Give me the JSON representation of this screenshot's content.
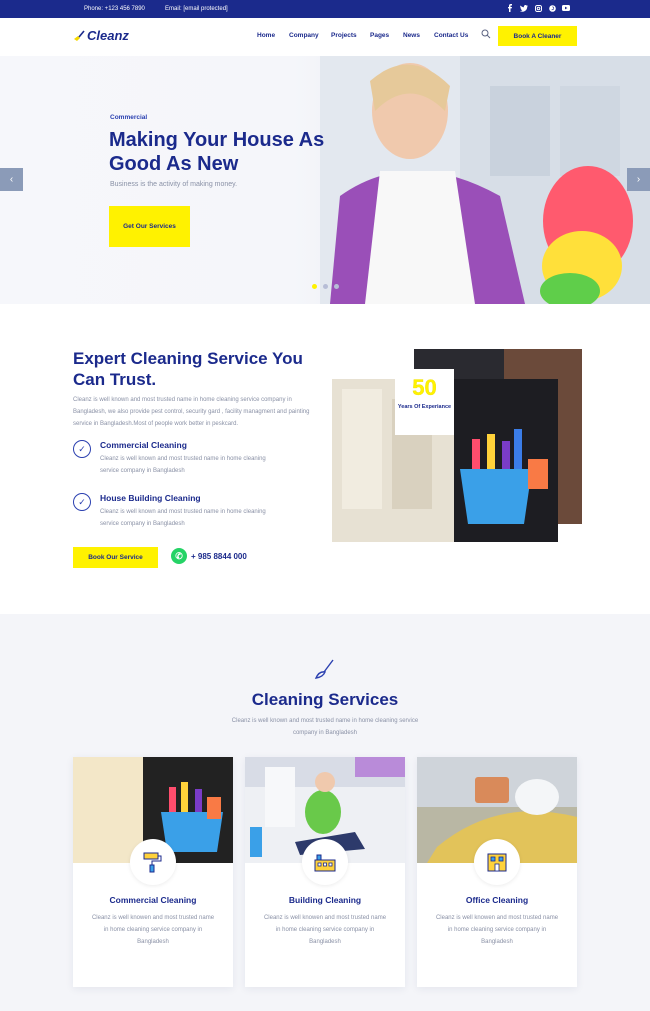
{
  "topbar": {
    "phone": "Phone: +123 456 7890",
    "email": "Email: [email protected]",
    "social": [
      "facebook-icon",
      "twitter-icon",
      "instagram-icon",
      "pinterest-icon",
      "youtube-icon"
    ]
  },
  "header": {
    "logo": "Cleanz",
    "nav": [
      "Home",
      "Company",
      "Projects",
      "Pages",
      "News",
      "Contact Us"
    ],
    "cta": "Book A Cleaner"
  },
  "hero": {
    "tag": "Commercial",
    "title": "Making Your House As Good As New",
    "subtitle": "Business is the activity of making money.",
    "button": "Get Our Services",
    "prev": "‹",
    "next": "›"
  },
  "about": {
    "title": "Expert Cleaning Service You Can Trust.",
    "description": "Cleanz is well known and most trusted name in home cleaning service company in Bangladesh, we also provide pest control, security gard , facility managment and painting service in Bangladesh.Most of people work better in peskcard.",
    "features": [
      {
        "title": "Commercial Cleaning",
        "desc": "Cleanz is well known and most trusted name in home cleaning service company in Bangladesh"
      },
      {
        "title": "House Building Cleaning",
        "desc": "Cleanz is well known and most trusted name in home cleaning service company in Bangladesh"
      }
    ],
    "button": "Book Our Service",
    "phone": "+ 985 8844 000",
    "badge_number": "50",
    "badge_label": "Years Of Experiance"
  },
  "services": {
    "title": "Cleaning Services",
    "lead": "Cleanz is well known and most trusted name in home cleaning service company in Bangladesh",
    "cards": [
      {
        "title": "Commercial Cleaning",
        "desc": "Cleanz is well knowen and most trusted name in home cleaning service company in Bangladesh"
      },
      {
        "title": "Building Cleaning",
        "desc": "Cleanz is well knowen and most trusted name in home cleaning service company in Bangladesh"
      },
      {
        "title": "Office Cleaning",
        "desc": "Cleanz is well knowen and most trusted name in home cleaning service company in Bangladesh"
      }
    ]
  },
  "colors": {
    "navy": "#1b2a8c",
    "accent": "#fff200",
    "muted": "#8a91a6",
    "light_bg": "#f4f5f9"
  }
}
